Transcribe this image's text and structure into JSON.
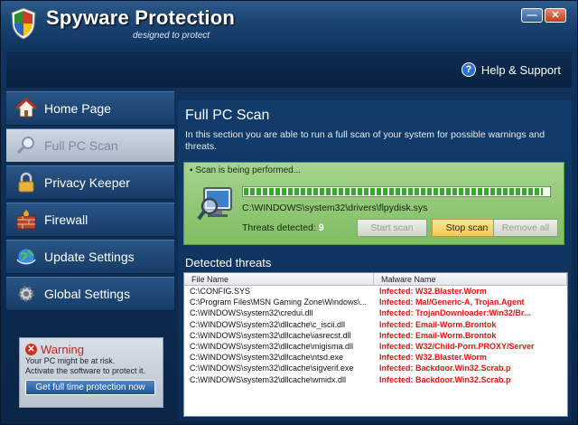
{
  "window": {
    "title": "Spyware Protection",
    "subtitle": "designed to protect",
    "minimize_symbol": "—",
    "close_symbol": "✕"
  },
  "header": {
    "help_label": "Help & Support",
    "help_icon": "?"
  },
  "sidebar": {
    "items": [
      {
        "label": "Home Page",
        "icon": "house-icon",
        "active": false
      },
      {
        "label": "Full PC Scan",
        "icon": "magnifier-icon",
        "active": true
      },
      {
        "label": "Privacy Keeper",
        "icon": "padlock-icon",
        "active": false
      },
      {
        "label": "Firewall",
        "icon": "firewall-icon",
        "active": false
      },
      {
        "label": "Update Settings",
        "icon": "globe-icon",
        "active": false
      },
      {
        "label": "Global Settings",
        "icon": "gear-icon",
        "active": false
      }
    ],
    "warning": {
      "title": "Warning",
      "icon_symbol": "✕",
      "line1": "Your PC might be at risk.",
      "line2": "Activate the software to protect it.",
      "button_label": "Get full time protection now"
    }
  },
  "main": {
    "title": "Full PC Scan",
    "description": "In this section you are able to run a full scan of your system for possible warnings and threats.",
    "scan": {
      "status": "Scan is being performed...",
      "progress_fraction": 0.98,
      "current_file": "C:\\WINDOWS\\system32\\drivers\\flpydisk.sys",
      "threats_label": "Threats detected:",
      "threats_count": "9",
      "start_label": "Start scan",
      "stop_label": "Stop scan",
      "remove_label": "Remove all"
    },
    "detected_title": "Detected threats",
    "table": {
      "headers": [
        "File Name",
        "Malware Name"
      ],
      "rows": [
        [
          "C:\\CONFIG.SYS",
          "Infected: W32.Blaster.Worm"
        ],
        [
          "C:\\Program Files\\MSN Gaming Zone\\Windows\\...",
          "Infected: Mal/Generic-A, Trojan.Agent"
        ],
        [
          "C:\\WINDOWS\\system32\\credui.dll",
          "Infected: TrojanDownloader:Win32/Br..."
        ],
        [
          "C:\\WINDOWS\\system32\\dllcache\\c_iscii.dll",
          "Infected: Email-Worm.Brontok"
        ],
        [
          "C:\\WINDOWS\\system32\\dllcache\\iasrecst.dll",
          "Infected: Email-Worm.Brontok"
        ],
        [
          "C:\\WINDOWS\\system32\\dllcache\\migisma.dll",
          "Infected: W32/Child-Porn.PROXY/Server"
        ],
        [
          "C:\\WINDOWS\\system32\\dllcache\\ntsd.exe",
          "Infected: W32.Blaster.Worm"
        ],
        [
          "C:\\WINDOWS\\system32\\dllcache\\sigverif.exe",
          "Infected: Backdoor.Win32.Scrab.p"
        ],
        [
          "C:\\WINDOWS\\system32\\dllcache\\wmidx.dll",
          "Infected: Backdoor.Win32.Scrab.p"
        ]
      ]
    }
  },
  "colors": {
    "accent": "#1b4472",
    "scan_panel": "#8fc873",
    "threat_text": "#e3140c",
    "warning_red": "#c0291a"
  }
}
